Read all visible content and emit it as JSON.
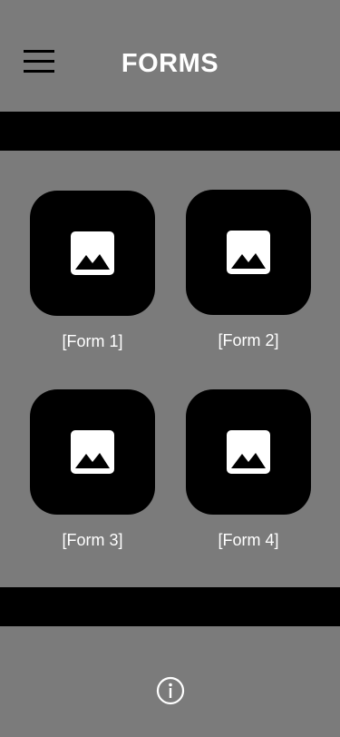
{
  "header": {
    "title": "FORMS",
    "menu_icon": "hamburger-menu-icon"
  },
  "forms": [
    {
      "label": "[Form 1]",
      "icon": "image-placeholder-icon"
    },
    {
      "label": "[Form 2]",
      "icon": "image-placeholder-icon"
    },
    {
      "label": "[Form 3]",
      "icon": "image-placeholder-icon"
    },
    {
      "label": "[Form 4]",
      "icon": "image-placeholder-icon"
    }
  ],
  "footer": {
    "info_icon": "info-icon"
  },
  "colors": {
    "background": "#7b7b7b",
    "band": "#000000",
    "tile": "#000000",
    "text": "#ffffff"
  }
}
